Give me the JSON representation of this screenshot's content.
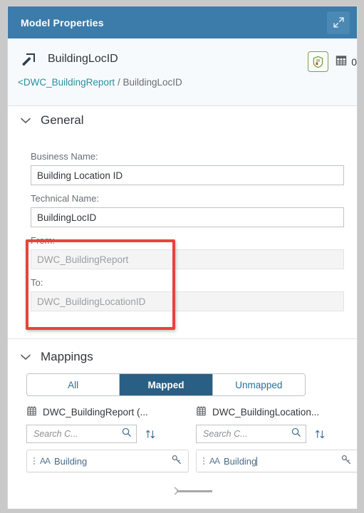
{
  "window": {
    "title": "Model Properties",
    "expand_icon": "expand-icon"
  },
  "object_header": {
    "icon": "association-arrow-icon",
    "name": "BuildingLocID",
    "validation_icon": "shield-check-icon",
    "records_icon": "table-grid-icon",
    "records_count": "0",
    "breadcrumb": {
      "parent": "<DWC_BuildingReport",
      "separator": "/",
      "current": "BuildingLocID"
    }
  },
  "general": {
    "title": "General",
    "chevron": "chevron-down-icon",
    "fields": [
      {
        "label": "Business Name:",
        "value": "Building Location ID",
        "readonly": false
      },
      {
        "label": "Technical Name:",
        "value": "BuildingLocID",
        "readonly": false
      },
      {
        "label": "From:",
        "value": "DWC_BuildingReport",
        "readonly": true
      },
      {
        "label": "To:",
        "value": "DWC_BuildingLocationID",
        "readonly": true
      }
    ]
  },
  "annotation": {
    "highlight_color": "#e8433b"
  },
  "mappings": {
    "title": "Mappings",
    "chevron": "chevron-down-icon",
    "filter_tabs": [
      {
        "label": "All",
        "active": false
      },
      {
        "label": "Mapped",
        "active": true
      },
      {
        "label": "Unmapped",
        "active": false
      }
    ],
    "columns": [
      {
        "icon": "table-entity-icon",
        "header": "DWC_BuildingReport (...",
        "search_placeholder": "Search C...",
        "search_icon": "magnifier-icon",
        "sort_icon": "sort-arrows-icon",
        "items": [
          {
            "grip": "drag-handle-icon",
            "type_icon": "AA",
            "label": "Building",
            "key_icon": "key-icon",
            "has_cursor": false
          }
        ]
      },
      {
        "icon": "table-entity-icon",
        "header": "DWC_BuildingLocation...",
        "search_placeholder": "Search C...",
        "search_icon": "magnifier-icon",
        "sort_icon": "sort-arrows-icon",
        "items": [
          {
            "grip": "drag-handle-icon",
            "type_icon": "AA",
            "label": "Building",
            "key_icon": "key-icon",
            "has_cursor": true
          }
        ]
      }
    ]
  },
  "colors": {
    "titlebar": "#3c7caa",
    "accent_selected": "#2a5f85",
    "link": "#2a8fa0",
    "highlight": "#e8433b",
    "validation_green": "#7a9f4e"
  }
}
